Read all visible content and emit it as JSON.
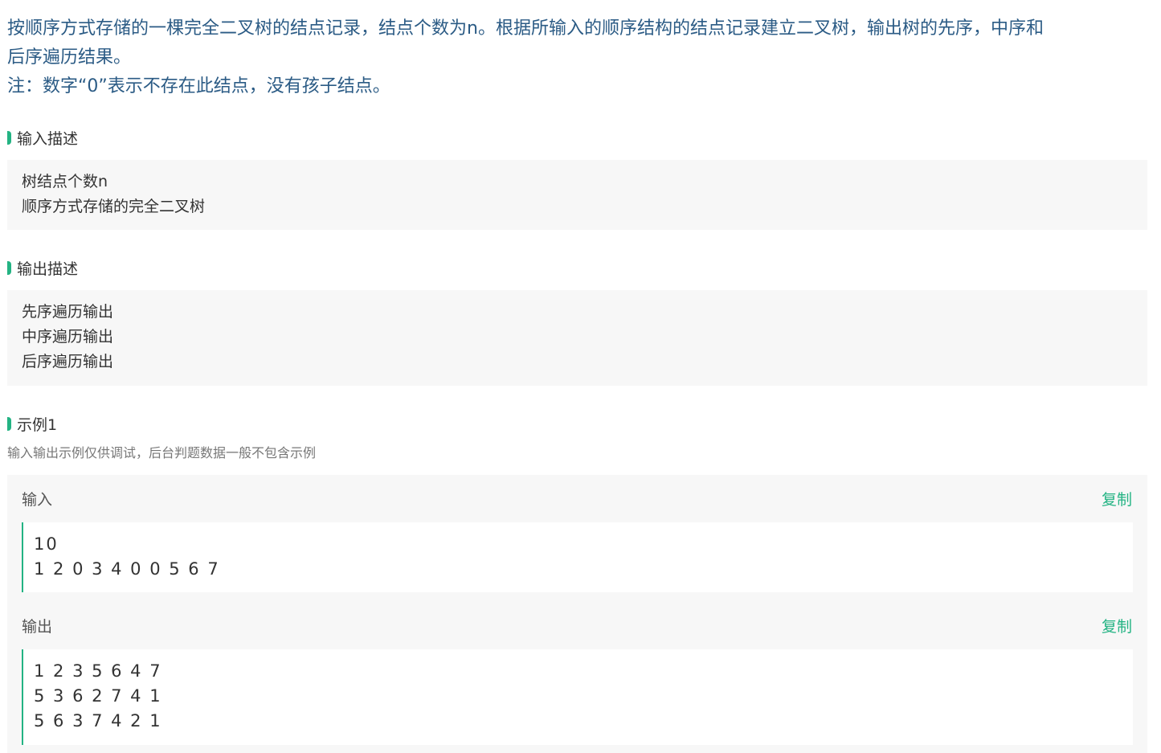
{
  "description": {
    "line1": "按顺序方式存储的一棵完全二叉树的结点记录，结点个数为n。根据所输入的顺序结构的结点记录建立二叉树，输出树的先序，中序和",
    "line2": "后序遍历结果。",
    "note": "注：数字“0”表示不存在此结点，没有孩子结点。"
  },
  "input_section": {
    "title": "输入描述",
    "lines": [
      "树结点个数n",
      "顺序方式存储的完全二叉树"
    ]
  },
  "output_section": {
    "title": "输出描述",
    "lines": [
      "先序遍历输出",
      "中序遍历输出",
      "后序遍历输出"
    ]
  },
  "example": {
    "title": "示例1",
    "hint": "输入输出示例仅供调试，后台判题数据一般不包含示例",
    "input_label": "输入",
    "output_label": "输出",
    "copy_label": "复制",
    "input_lines": [
      "10",
      "1 2 0 3 4 0 0 5 6 7"
    ],
    "output_lines": [
      "1 2 3 5 6 4 7",
      "5 3 6 2 7 4 1",
      "5 6 3 7 4 2 1"
    ]
  },
  "colors": {
    "accent": "#23b383",
    "description_text": "#2b5b85",
    "panel_bg": "#f7f7f7"
  }
}
